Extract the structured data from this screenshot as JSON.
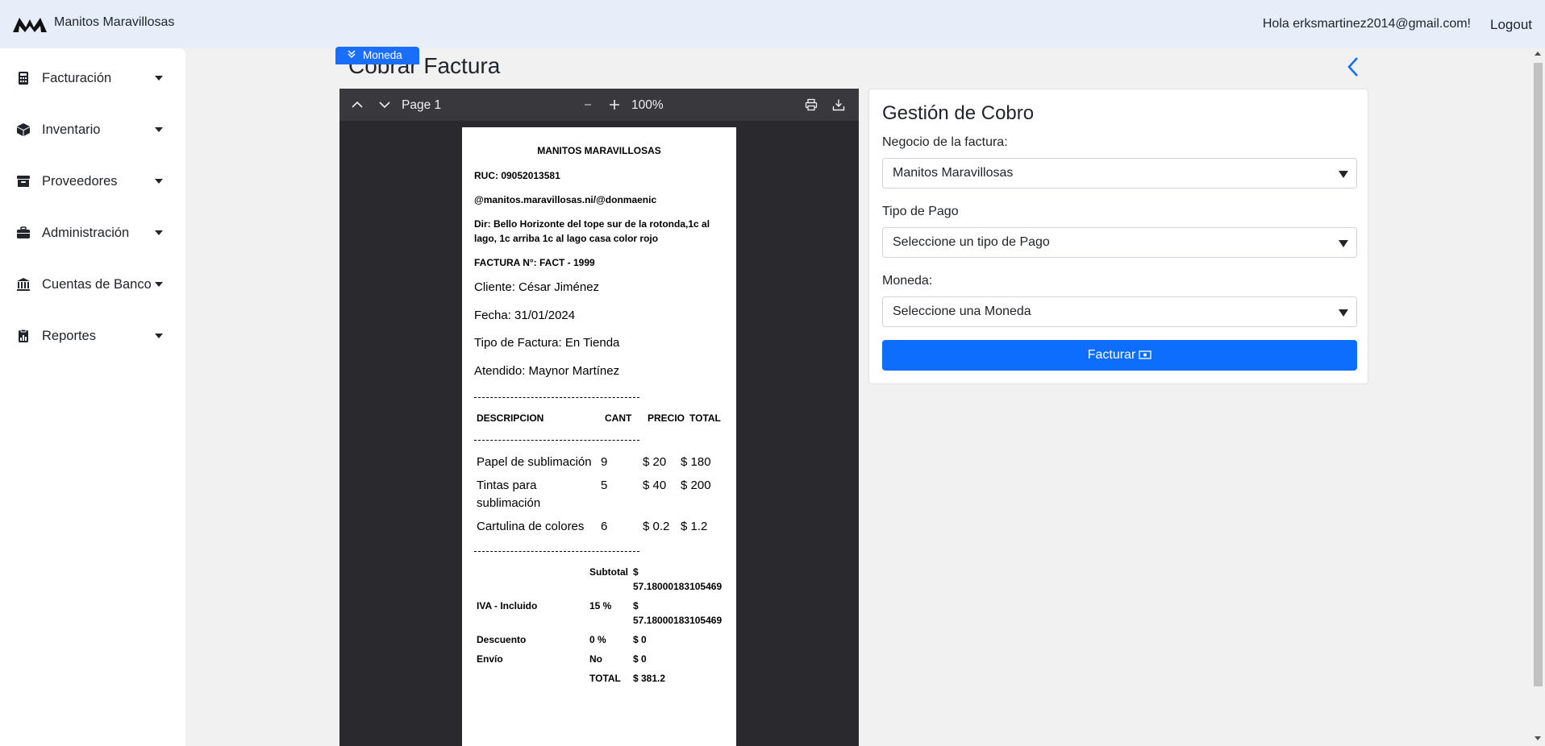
{
  "header": {
    "brand": "Manitos Maravillosas",
    "greeting": "Hola erksmartinez2014@gmail.com!",
    "logout": "Logout"
  },
  "sidebar": {
    "items": [
      {
        "label": "Facturación",
        "icon": "calculator-icon"
      },
      {
        "label": "Inventario",
        "icon": "box-icon"
      },
      {
        "label": "Proveedores",
        "icon": "archive-icon"
      },
      {
        "label": "Administración",
        "icon": "briefcase-icon"
      },
      {
        "label": "Cuentas de Banco",
        "icon": "bank-icon"
      },
      {
        "label": "Reportes",
        "icon": "report-icon"
      }
    ]
  },
  "main": {
    "title": "Cobrar Factura",
    "moneda_chip": "Moneda"
  },
  "viewer": {
    "page_label": "Page 1",
    "zoom": "100%"
  },
  "invoice": {
    "business": "MANITOS MARAVILLOSAS",
    "ruc": "RUC: 09052013581",
    "social": "@manitos.maravillosas.ni/@donmaenic",
    "address_line1": "Dir: Bello Horizonte del tope sur de la rotonda,1c al",
    "address_line2": "lago, 1c arriba 1c al lago casa color rojo",
    "invoice_no": "FACTURA N°: FACT - 1999",
    "client": "Cliente: César Jiménez",
    "date": "Fecha: 31/01/2024",
    "type": "Tipo de Factura: En Tienda",
    "attended": "Atendido: Maynor Martínez",
    "dashes": "----------------------------------------------------",
    "headers": {
      "desc": "DESCRIPCION",
      "qty": "CANT",
      "price": "PRECIO",
      "total": "TOTAL"
    },
    "items": [
      {
        "desc1": "Papel de sublimación",
        "desc2": "",
        "qty": "9",
        "price": "$ 20",
        "total": "$ 180"
      },
      {
        "desc1": "Tintas para",
        "desc2": "sublimación",
        "qty": "5",
        "price": "$ 40",
        "total": "$ 200"
      },
      {
        "desc1": "Cartulina de colores",
        "desc2": "",
        "qty": "6",
        "price": "$ 0.2",
        "total": "$ 1.2"
      }
    ],
    "summary": {
      "subtotal_label": "Subtotal",
      "subtotal_value1": "$",
      "subtotal_value2": "57.18000183105469",
      "iva_label": "IVA - Incluido",
      "iva_pct": "15 %",
      "iva_value1": "$",
      "iva_value2": "57.18000183105469",
      "discount_label": "Descuento",
      "discount_pct": "0 %",
      "discount_value": "$ 0",
      "shipping_label": "Envío",
      "shipping_flag": "No",
      "shipping_value": "$ 0",
      "total_label": "TOTAL",
      "total_value": "$ 381.2"
    }
  },
  "form": {
    "title": "Gestión de Cobro",
    "business_label": "Negocio de la factura:",
    "business_value": "Manitos Maravillosas",
    "payment_label": "Tipo de Pago",
    "payment_value": "Seleccione un tipo de Pago",
    "currency_label": "Moneda:",
    "currency_value": "Seleccione una Moneda",
    "submit": "Facturar"
  },
  "colors": {
    "primary": "#0d6efd",
    "topbar": "#e6eefa",
    "viewer_bg": "#2a2a2e"
  }
}
